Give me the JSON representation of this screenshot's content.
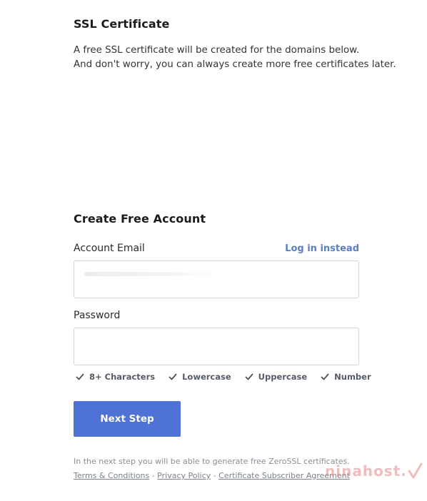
{
  "ssl": {
    "title": "SSL Certificate",
    "desc_line1": "A free SSL certificate will be created for the domains below.",
    "desc_line2": "And don't worry, you can always create more free certificates later."
  },
  "account": {
    "title": "Create Free Account",
    "email_label": "Account Email",
    "login_link": "Log in instead",
    "email_value": "",
    "password_label": "Password",
    "password_value": ""
  },
  "requirements": [
    {
      "label": "8+ Characters",
      "icon": "check-icon"
    },
    {
      "label": "Lowercase",
      "icon": "check-icon"
    },
    {
      "label": "Uppercase",
      "icon": "check-icon"
    },
    {
      "label": "Number",
      "icon": "check-icon"
    }
  ],
  "next_button": "Next Step",
  "footer": {
    "note": "In the next step you will be able to generate free ZeroSSL certificates.",
    "links": [
      "Terms & Conditions",
      "Privacy Policy",
      "Certificate Subscriber Agreement"
    ],
    "separator": "-"
  },
  "watermark": "ninahost.",
  "colors": {
    "accent": "#4f72d6",
    "link": "#5b7fc0",
    "check": "#4a5260",
    "watermark": "#e38a86"
  }
}
